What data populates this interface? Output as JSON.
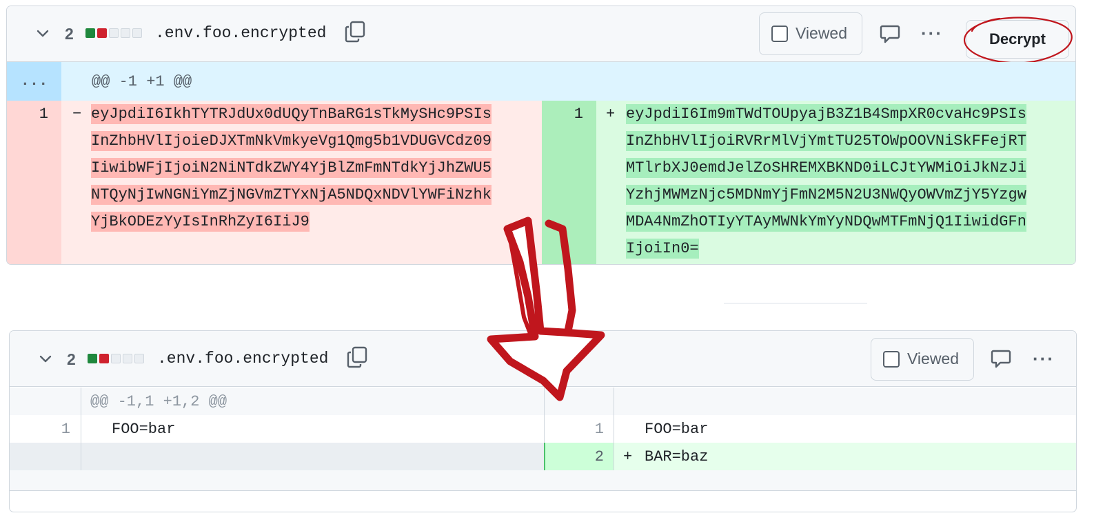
{
  "top_diff": {
    "changes_count": "2",
    "filename": ".env.foo.encrypted",
    "viewed_label": "Viewed",
    "decrypt_label": "Decrypt",
    "more_label": "···",
    "expand_label": "...",
    "hunk_header": "@@ -1 +1 @@",
    "left": {
      "line_number": "1",
      "sign": "−",
      "lines": [
        "eyJpdiI6IkhTYTRJdUx0dUQyTnBaRG1sTkMySHc9PSIs",
        "InZhbHVlIjoieDJXTmNkVmkyeVg1Qmg5b1VDUGVCdz09",
        "IiwibWFjIjoiN2NiNTdkZWY4YjBlZmFmNTdkYjJhZWU5",
        "NTQyNjIwNGNiYmZjNGVmZTYxNjA5NDQxNDVlYWFiNzhk",
        "YjBkODEzYyIsInRhZyI6IiJ9"
      ]
    },
    "right": {
      "line_number": "1",
      "sign": "+",
      "lines": [
        "eyJpdiI6Im9mTWdTOUpyajB3Z1B4SmpXR0cvaHc9PSIs",
        "InZhbHVlIjoiRVRrMlVjYmtTU25TOWpOOVNiSkFFejRT",
        "MTlrbXJ0emdJelZoSHREMXBKND0iLCJtYWMiOiJkNzJi",
        "YzhjMWMzNjc5MDNmYjFmN2M5N2U3NWQyOWVmZjY5Yzgw",
        "MDA4NmZhOTIyYTAyMWNkYmYyNDQwMTFmNjQ1IiwidGFn",
        "IjoiIn0="
      ]
    }
  },
  "bottom_diff": {
    "changes_count": "2",
    "filename": ".env.foo.encrypted",
    "viewed_label": "Viewed",
    "more_label": "···",
    "hunk_header": "@@ -1,1 +1,2 @@",
    "rows": [
      {
        "left_num": "1",
        "left_text": "FOO=bar",
        "right_num": "1",
        "right_sign": "",
        "right_text": "FOO=bar"
      },
      {
        "left_num": "",
        "left_text": "",
        "right_num": "2",
        "right_sign": "+",
        "right_text": "BAR=baz"
      }
    ]
  },
  "colors": {
    "add_square": "#1f883d",
    "del_square": "#cf222e",
    "neutral_square": "#eaeef2",
    "annotation_red": "#c0161d"
  },
  "icons": [
    "chevron-down-icon",
    "copy-icon",
    "comment-icon",
    "kebab-icon",
    "checkbox-icon",
    "arrow-down-annotation"
  ]
}
